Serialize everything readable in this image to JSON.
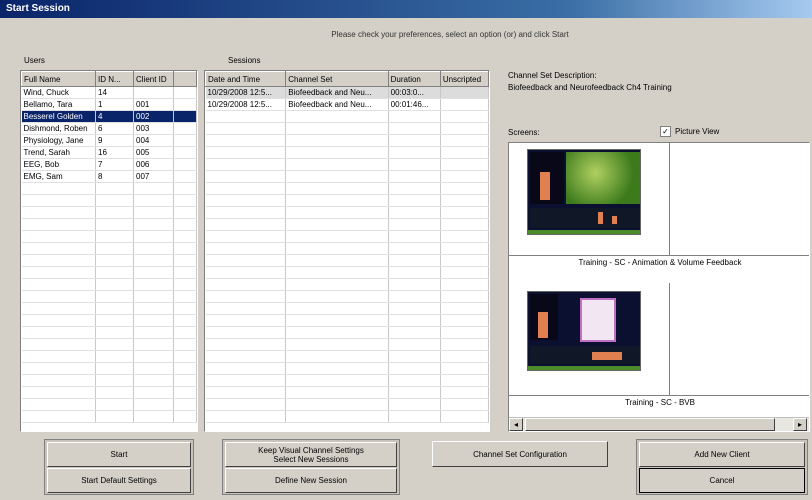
{
  "window": {
    "title": "Start Session"
  },
  "instruction": "Please check your preferences, select an option (or) and click Start",
  "users": {
    "label": "Users",
    "columns": [
      "Full Name",
      "ID N...",
      "Client ID"
    ],
    "rows": [
      [
        "Wind, Chuck",
        "14",
        ""
      ],
      [
        "Bellamo, Tara",
        "1",
        "001"
      ],
      [
        "Besserel Golden",
        "4",
        "002"
      ],
      [
        "Dishmond, Roben",
        "6",
        "003"
      ],
      [
        "Physiology, Jane",
        "9",
        "004"
      ],
      [
        "Trend, Sarah",
        "16",
        "005"
      ],
      [
        "EEG, Bob",
        "7",
        "006"
      ],
      [
        "EMG, Sam",
        "8",
        "007"
      ]
    ],
    "selected_index": 2
  },
  "sessions": {
    "label": "Sessions",
    "columns": [
      "Date and Time",
      "Channel Set",
      "Duration",
      "Unscripted"
    ],
    "rows": [
      [
        "10/29/2008 12:5...",
        "Biofeedback and Neu...",
        "00:03:0...",
        ""
      ],
      [
        "10/29/2008 12:5...",
        "Biofeedback and Neu...",
        "00:01:46...",
        ""
      ]
    ]
  },
  "channel_set": {
    "desc_label": "Channel Set Description:",
    "desc_value": "Biofeedback and Neurofeedback Ch4 Training",
    "screens_label": "Screens:",
    "picture_view_label": "Picture View",
    "picture_view_checked": true,
    "screens": [
      {
        "caption": "Training - SC - Animation & Volume Feedback"
      },
      {
        "caption": "Training - SC - BVB"
      }
    ]
  },
  "buttons": {
    "start": "Start",
    "start_default": "Start Default Settings",
    "keep_visual": "Keep Visual Channel Settings\nSelect New Sessions",
    "define_new": "Define New Session",
    "channel_config": "Channel Set Configuration",
    "add_client": "Add New Client",
    "cancel": "Cancel"
  }
}
